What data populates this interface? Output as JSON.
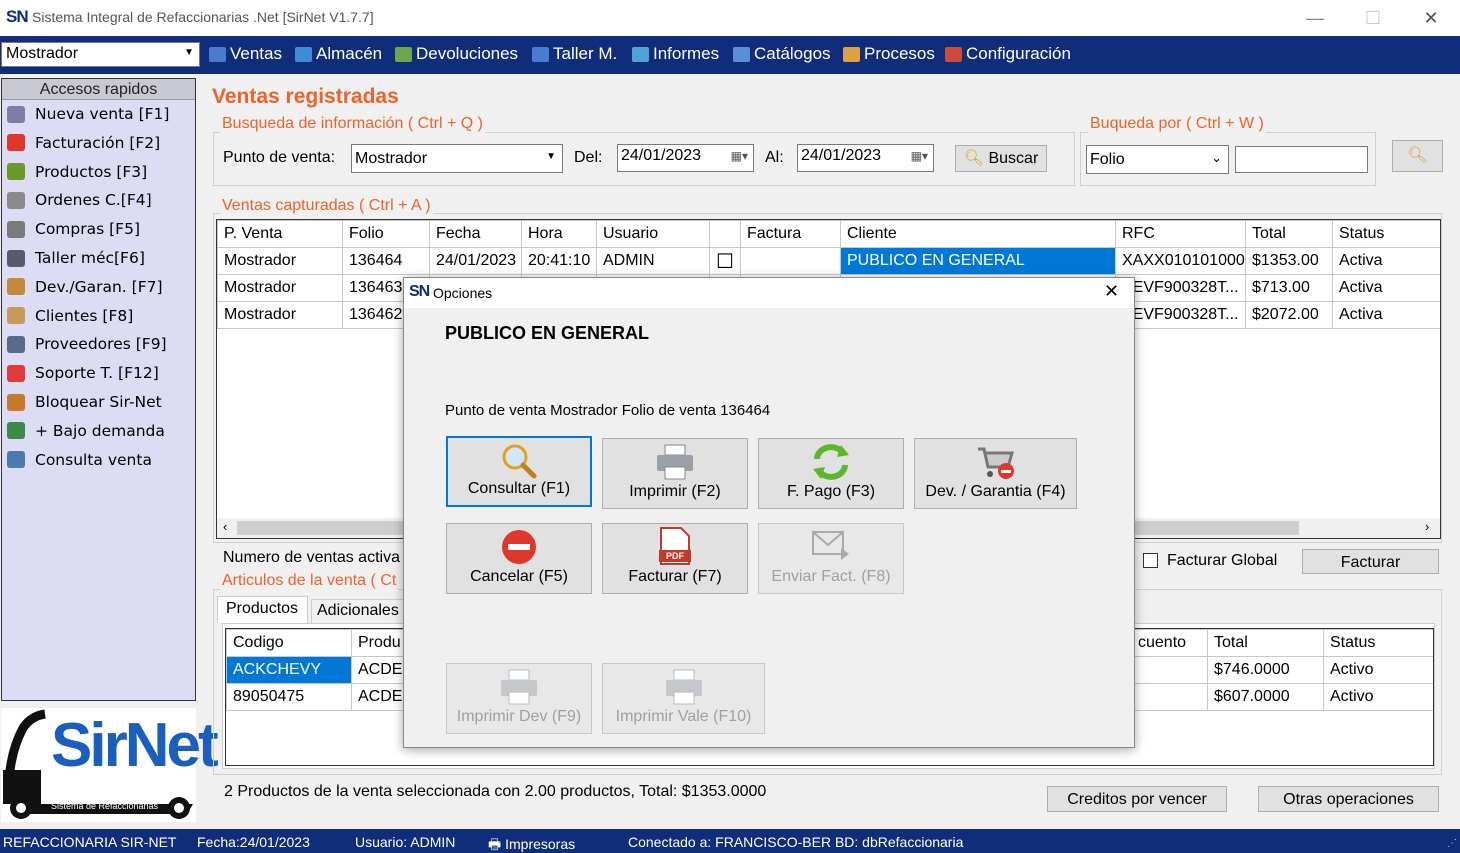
{
  "window": {
    "logo": "SN",
    "title": "Sistema Integral de Refaccionarias .Net [SirNet V1.7.7]",
    "minimize": "—",
    "maximize": "☐",
    "close": "✕"
  },
  "menubar": {
    "location": "Mostrador",
    "items": [
      {
        "label": "Ventas",
        "icon": "sales-icon",
        "color": "#4a7bd0"
      },
      {
        "label": "Almacén",
        "icon": "warehouse-icon",
        "color": "#3f8bd8"
      },
      {
        "label": "Devoluciones",
        "icon": "returns-icon",
        "color": "#6ea74b"
      },
      {
        "label": "Taller M.",
        "icon": "workshop-icon",
        "color": "#4a7bd0"
      },
      {
        "label": "Informes",
        "icon": "reports-icon",
        "color": "#4fa3d8"
      },
      {
        "label": "Catálogos",
        "icon": "catalogs-icon",
        "color": "#5a8fd8"
      },
      {
        "label": "Procesos",
        "icon": "processes-icon",
        "color": "#e0a040"
      },
      {
        "label": "Configuración",
        "icon": "settings-icon",
        "color": "#d04a3a"
      }
    ]
  },
  "sidebar": {
    "title": "Accesos rapidos",
    "items": [
      {
        "label": "Nueva venta [F1]",
        "icon": "cash-register-icon",
        "color": "#7d7da6"
      },
      {
        "label": "Facturación [F2]",
        "icon": "pdf-icon",
        "color": "#e0372c"
      },
      {
        "label": "Productos [F3]",
        "icon": "wrench-icon",
        "color": "#6a9a2a"
      },
      {
        "label": "Ordenes C.[F4]",
        "icon": "cart-icon",
        "color": "#8a8a8a"
      },
      {
        "label": "Compras [F5]",
        "icon": "shopping-cart-icon",
        "color": "#7a7a7a"
      },
      {
        "label": "Taller méc[F6]",
        "icon": "car-icon",
        "color": "#5a5a6a"
      },
      {
        "label": "Dev./Garan. [F7]",
        "icon": "cart-return-icon",
        "color": "#c08a3a"
      },
      {
        "label": "Clientes [F8]",
        "icon": "user-icon",
        "color": "#c89a5a"
      },
      {
        "label": "Proveedores [F9]",
        "icon": "supplier-icon",
        "color": "#5a6a8a"
      },
      {
        "label": "Soporte T. [F12]",
        "icon": "lifebuoy-icon",
        "color": "#e03a3a"
      },
      {
        "label": "Bloquear Sir-Net",
        "icon": "lock-user-icon",
        "color": "#c8782a"
      },
      {
        "label": "+ Bajo demanda",
        "icon": "add-window-icon",
        "color": "#3a8a4a"
      },
      {
        "label": "Consulta venta",
        "icon": "search-doc-icon",
        "color": "#4a7ab0"
      }
    ]
  },
  "logo": {
    "text": "SirNet",
    "subtitle": "Sistema de Refaccionarias"
  },
  "main": {
    "title": "Ventas registradas",
    "search_group": "Busqueda de información ( Ctrl + Q )",
    "point_label": "Punto de venta:",
    "point_value": "Mostrador",
    "from_label": "Del:",
    "from_value": "24/01/2023",
    "to_label": "Al:",
    "to_value": "24/01/2023",
    "search_button": "Buscar",
    "searchby_group": "Buqueda por ( Ctrl + W )",
    "searchby_value": "Folio",
    "searchby_input": "",
    "sales_group": "Ventas capturadas ( Ctrl + A )",
    "sales_columns": [
      "P. Venta",
      "Folio",
      "Fecha",
      "Hora",
      "Usuario",
      "",
      "Factura",
      "Cliente",
      "RFC",
      "Total",
      "Status"
    ],
    "sales_rows": [
      [
        "Mostrador",
        "136464",
        "24/01/2023",
        "20:41:10",
        "ADMIN",
        "☐",
        "",
        "PUBLICO EN GENERAL",
        "XAXX010101000",
        "$1353.00",
        "Activa"
      ],
      [
        "Mostrador",
        "136463",
        "",
        "",
        "",
        "",
        "",
        "",
        "BEVF900328T...",
        "$713.00",
        "Activa"
      ],
      [
        "Mostrador",
        "136462",
        "",
        "",
        "",
        "",
        "",
        "",
        "BEVF900328T...",
        "$2072.00",
        "Activa"
      ]
    ],
    "count_label": "Numero de ventas activa",
    "global_invoice": "Facturar Global",
    "invoice_button": "Facturar",
    "articles_group": "Articulos de la venta ( Ct",
    "tabs": [
      "Productos",
      "Adicionales"
    ],
    "article_columns_left": [
      "Codigo",
      "Produ"
    ],
    "article_columns_right": [
      "cuento",
      "Total",
      "Status"
    ],
    "article_rows": [
      {
        "code": "ACKCHEVY",
        "prod": "ACDE",
        "disc": "",
        "total": "$746.0000",
        "status": "Activo"
      },
      {
        "code": "89050475",
        "prod": "ACDE",
        "disc": "",
        "total": "$607.0000",
        "status": "Activo"
      }
    ],
    "summary": "2 Productos de la venta seleccionada con 2.00 productos,  Total: $1353.0000",
    "credits_button": "Creditos por vencer",
    "other_ops_button": "Otras operaciones"
  },
  "statusbar": {
    "company": "REFACCIONARIA SIR-NET",
    "date": "Fecha:24/01/2023",
    "user": "Usuario: ADMIN",
    "printers": "Impresoras",
    "connection": "Conectado a: FRANCISCO-BER BD: dbRefaccionaria"
  },
  "dialog": {
    "logo": "SN",
    "title": "Opciones",
    "close": "✕",
    "client": "PUBLICO EN GENERAL",
    "info": "Punto de venta Mostrador Folio de venta 136464",
    "buttons": {
      "consult": "Consultar (F1)",
      "print": "Imprimir (F2)",
      "payment": "F. Pago (F3)",
      "return": "Dev. / Garantia (F4)",
      "cancel": "Cancelar (F5)",
      "invoice": "Facturar (F7)",
      "send_invoice": "Enviar Fact. (F8)",
      "print_return": "Imprimir Dev (F9)",
      "print_voucher": "Imprimir Vale (F10)"
    }
  }
}
